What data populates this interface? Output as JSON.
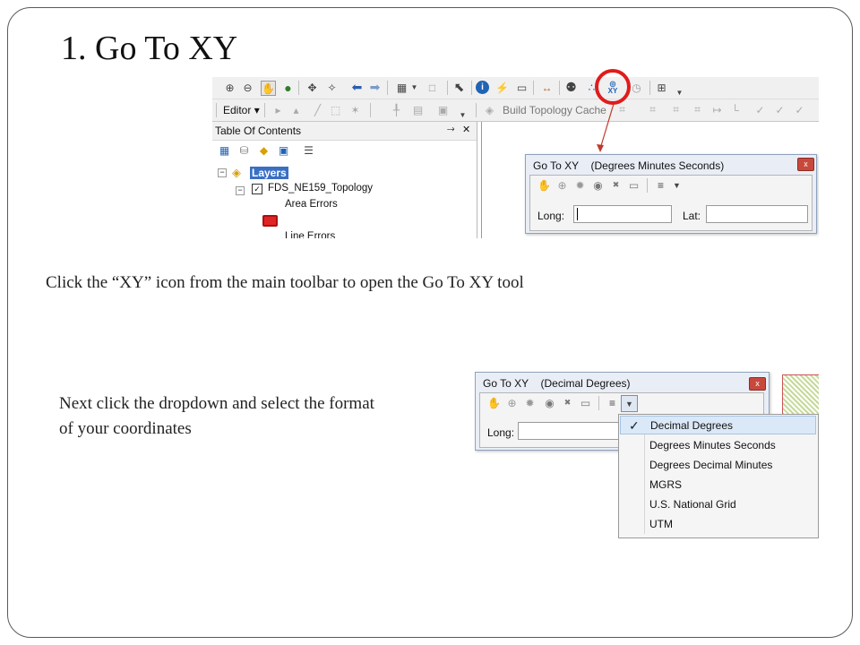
{
  "slide": {
    "title": "1. Go To XY",
    "caption1": "Click the “XY” icon from the main toolbar to open the Go To XY tool",
    "caption2_line1": "Next click the dropdown and select the format",
    "caption2_line2": "of your coordinates",
    "highlight_color": "#e01b1b"
  },
  "screenshot1": {
    "editor_label": "Editor",
    "build_topology_label": "Build Topology Cache",
    "xy_button_label": "XY",
    "toc": {
      "title": "Table Of Contents",
      "pin_icon": "✕",
      "layers_label": "Layers",
      "topology_label": "FDS_NE159_Topology",
      "area_errors_label": "Area Errors",
      "line_errors_label": "Line Errors"
    },
    "goto_dialog": {
      "title": "Go To XY",
      "format": "(Degrees Minutes Seconds)",
      "long_label": "Long:",
      "lat_label": "Lat:",
      "close_icon": "x"
    }
  },
  "screenshot2": {
    "goto_dialog": {
      "title": "Go To XY",
      "format": "(Decimal Degrees)",
      "long_label": "Long:",
      "close_icon": "x"
    },
    "dropdown": {
      "selected_index": 0,
      "check_mark": "✓",
      "options": [
        "Decimal Degrees",
        "Degrees Minutes Seconds",
        "Degrees Decimal Minutes",
        "MGRS",
        "U.S. National Grid",
        "UTM"
      ]
    }
  }
}
